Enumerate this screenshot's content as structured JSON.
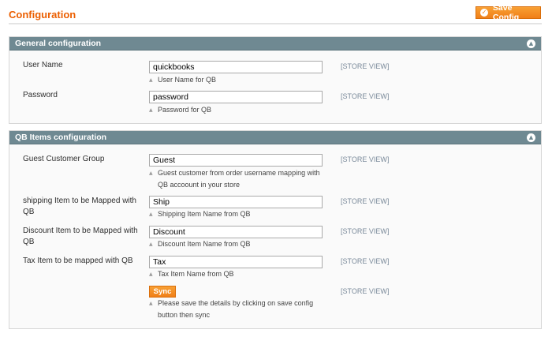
{
  "page": {
    "title": "Configuration",
    "save_label": "Save Config"
  },
  "general": {
    "title": "General configuration",
    "fields": [
      {
        "label": "User Name",
        "value": "quickbooks",
        "note": "User Name for QB",
        "scope": "[STORE VIEW]"
      },
      {
        "label": "Password",
        "value": "password",
        "note": "Password for QB",
        "scope": "[STORE VIEW]"
      }
    ]
  },
  "items": {
    "title": "QB Items configuration",
    "fields": [
      {
        "label": "Guest Customer Group",
        "value": "Guest",
        "note": "Guest customer from order username mapping with QB accoount in your store",
        "scope": "[STORE VIEW]"
      },
      {
        "label": "shipping Item to be Mapped with QB",
        "value": "Ship",
        "note": "Shipping Item Name from QB",
        "scope": "[STORE VIEW]"
      },
      {
        "label": "Discount Item to be Mapped with QB",
        "value": "Discount",
        "note": "Discount Item Name from QB",
        "scope": "[STORE VIEW]"
      },
      {
        "label": "Tax Item to be mapped with QB",
        "value": "Tax",
        "note": "Tax Item Name from QB",
        "scope": "[STORE VIEW]"
      }
    ],
    "sync": {
      "label": "Sync",
      "note": "Please save the details by clicking on save config button then sync",
      "scope": "[STORE VIEW]"
    }
  },
  "colors": {
    "accent": "#eb5e00",
    "button": "#f07f18",
    "section_header": "#6f8992"
  },
  "icons": {
    "save": "check-circle-icon",
    "collapse": "chevron-up-icon"
  }
}
